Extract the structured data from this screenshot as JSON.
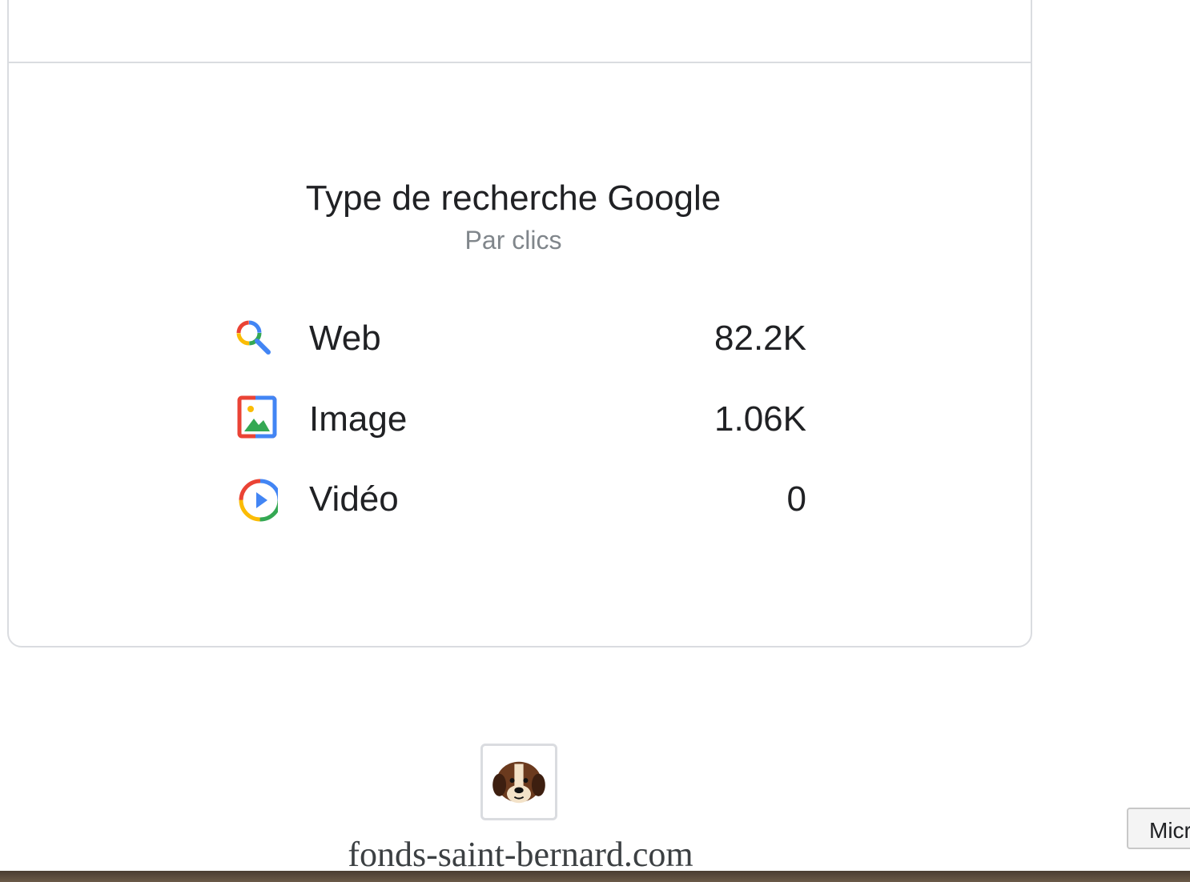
{
  "card": {
    "title": "Type de recherche Google",
    "subtitle": "Par clics",
    "rows": [
      {
        "label": "Web",
        "value": "82.2K",
        "icon": "search-icon"
      },
      {
        "label": "Image",
        "value": "1.06K",
        "icon": "image-icon"
      },
      {
        "label": "Vidéo",
        "value": "0",
        "icon": "video-play-icon"
      }
    ]
  },
  "footer": {
    "site": "fonds-saint-bernard.com",
    "logo_icon": "saint-bernard-dog-icon"
  },
  "side_button": {
    "label": "Micr"
  },
  "colors": {
    "google_blue": "#4285F4",
    "google_red": "#EA4335",
    "google_yellow": "#FBBC05",
    "google_green": "#34A853"
  }
}
